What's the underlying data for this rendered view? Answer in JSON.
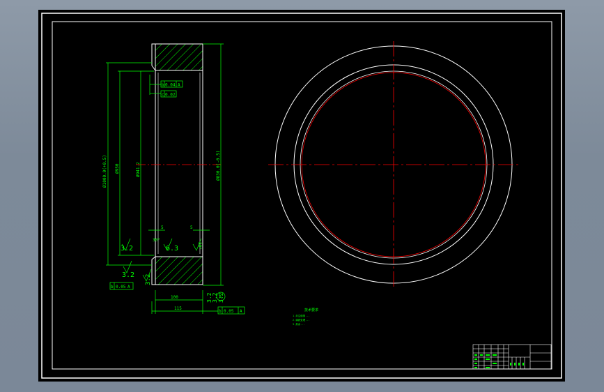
{
  "drawing": {
    "theme": {
      "background": "#000000",
      "outline_color": "#ffffff",
      "dimension_color": "#00ff00",
      "centerline_color": "#ff0000",
      "hatch_color": "#00ff00"
    },
    "section_view": {
      "left_dims": [
        "Ø1000.0(+0.5)",
        "Ø950"
      ],
      "inner_dim": "Ø941.2",
      "right_dim": "Ø830.0(-0.5)",
      "tolerance_frame_1": {
        "symbol": "b",
        "value": "0.04",
        "datum": "A"
      },
      "tolerance_frame_2": {
        "symbol": "c",
        "value": "0.02"
      },
      "tolerance_frame_bottom_left": {
        "symbol": "b",
        "value": "0.05",
        "datum": "A"
      },
      "tolerance_frame_bottom_right": {
        "symbol": "b",
        "value": "0.05",
        "datum": "A"
      },
      "roughness": [
        "3.2",
        "3.2",
        "6.3",
        "3.2"
      ],
      "chamfers": [
        "5",
        "5",
        "30°",
        "30°"
      ],
      "bottom_dims": [
        "100",
        "115"
      ],
      "small_dims": [
        "3.2",
        "3.2",
        "3.2"
      ],
      "datum_label": "A"
    },
    "notes": {
      "title": "技术要求",
      "lines": [
        "1.未注倒角...",
        "2.调质处理...",
        "3.其余..."
      ]
    },
    "title_block": {
      "visible": true
    }
  }
}
